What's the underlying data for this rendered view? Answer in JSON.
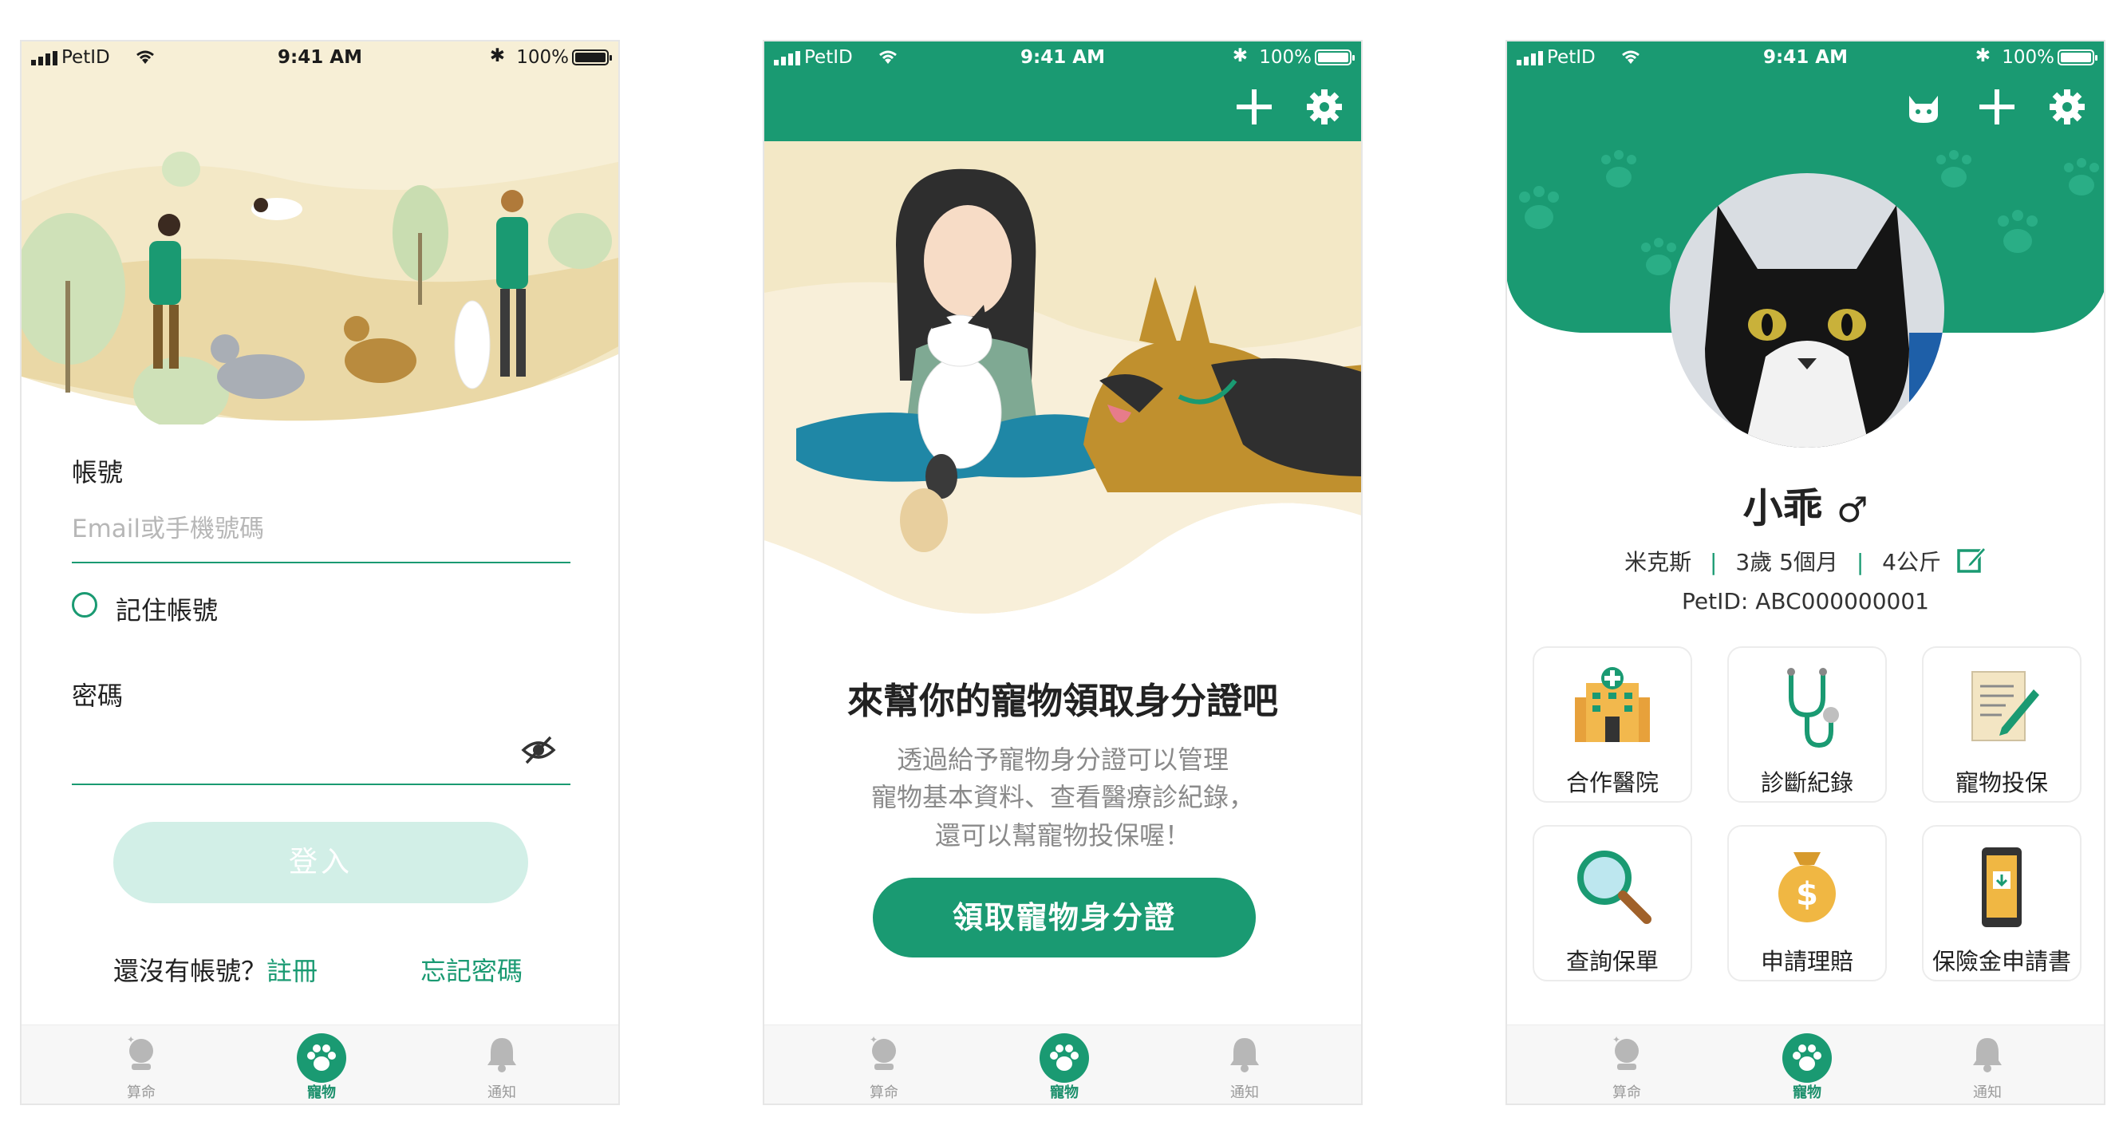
{
  "status_bar": {
    "carrier": "PetID",
    "time": "9:41 AM",
    "battery": "100%"
  },
  "tabbar": {
    "items": [
      {
        "label": "算命",
        "icon": "crystal-ball-icon",
        "active": false
      },
      {
        "label": "寵物",
        "icon": "paw-icon",
        "active": true
      },
      {
        "label": "通知",
        "icon": "bell-icon",
        "active": false
      }
    ]
  },
  "login": {
    "account_label": "帳號",
    "account_placeholder": "Email或手機號碼",
    "remember_label": "記住帳號",
    "password_label": "密碼",
    "login_button": "登入",
    "no_account": "還沒有帳號？",
    "register_link": "註冊",
    "forgot_link": "忘記密碼"
  },
  "onboarding": {
    "headline": "來幫你的寵物領取身分證吧",
    "desc_line1": "透過給予寵物身分證可以管理",
    "desc_line2": "寵物基本資料、查看醫療診紀錄，",
    "desc_line3": "還可以幫寵物投保喔！",
    "cta_button": "領取寵物身分證"
  },
  "profile": {
    "name": "小乖",
    "gender_symbol": "♂",
    "breed": "米克斯",
    "age": "3歲 5個月",
    "weight": "4公斤",
    "pet_id": "PetID: ABC000000001",
    "services": [
      {
        "label": "合作醫院",
        "icon": "hospital-icon"
      },
      {
        "label": "診斷紀錄",
        "icon": "stethoscope-icon"
      },
      {
        "label": "寵物投保",
        "icon": "insurance-document-icon"
      },
      {
        "label": "查詢保單",
        "icon": "magnifier-icon"
      },
      {
        "label": "申請理賠",
        "icon": "money-bag-icon"
      },
      {
        "label": "保險金申請書",
        "icon": "phone-download-icon"
      }
    ]
  },
  "colors": {
    "brand_green": "#1a9a72",
    "sand": "#f3e8c6"
  }
}
